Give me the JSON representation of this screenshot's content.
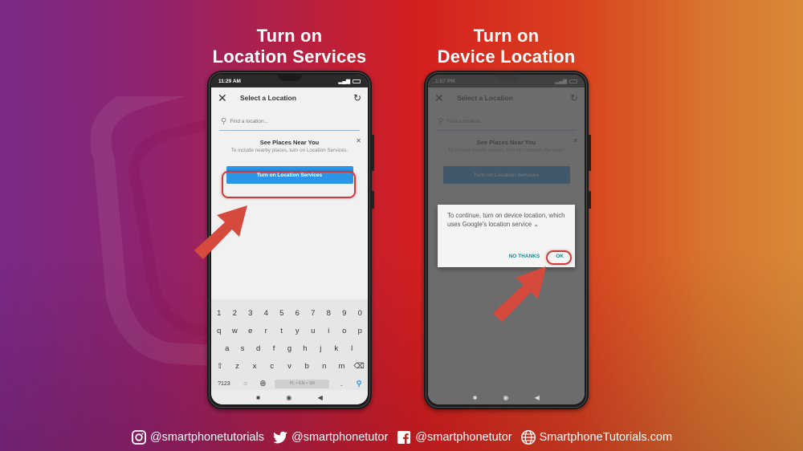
{
  "headings": {
    "left": [
      "Turn on",
      "Location Services"
    ],
    "right": [
      "Turn on",
      "Device Location"
    ]
  },
  "phone_left": {
    "status_time": "11:29 AM",
    "app_title": "Select a Location",
    "search_placeholder": "Find a location...",
    "near_title": "See Places Near You",
    "near_desc": "To include nearby places, turn on Location Services.",
    "button_label": "Turn on Location Services",
    "keyboard": {
      "row1": [
        "1",
        "2",
        "3",
        "4",
        "5",
        "6",
        "7",
        "8",
        "9",
        "0"
      ],
      "row2": [
        "q",
        "w",
        "e",
        "r",
        "t",
        "y",
        "u",
        "i",
        "o",
        "p"
      ],
      "row3": [
        "a",
        "s",
        "d",
        "f",
        "g",
        "h",
        "j",
        "k",
        "l"
      ],
      "row4": [
        "⇧",
        "z",
        "x",
        "c",
        "v",
        "b",
        "n",
        "m",
        "⌫"
      ],
      "sym_key": "?123",
      "space_label": "PL • EN • SR",
      "period": ".",
      "search_key": "search-icon"
    },
    "nav": [
      "■",
      "◉",
      "◀"
    ]
  },
  "phone_right": {
    "status_time": "1:57 PM",
    "app_title": "Select a Location",
    "search_placeholder": "Find a location...",
    "near_title": "See Places Near You",
    "near_desc": "To include nearby places, turn on Location Services.",
    "button_label": "Turn on Location Services",
    "dialog": {
      "message": "To continue, turn on device location, which uses Google's location service ⌄",
      "no_thanks": "NO THANKS",
      "ok": "OK"
    },
    "nav": [
      "■",
      "◉",
      "◀"
    ]
  },
  "footer": {
    "instagram": "@smartphonetutorials",
    "twitter": "@smartphonetutor",
    "facebook": "@smartphonetutor",
    "website": "SmartphoneTutorials.com"
  },
  "colors": {
    "highlight": "#d23a3a",
    "primary_button": "#2b95e8",
    "dialog_action": "#1a8a8c"
  }
}
